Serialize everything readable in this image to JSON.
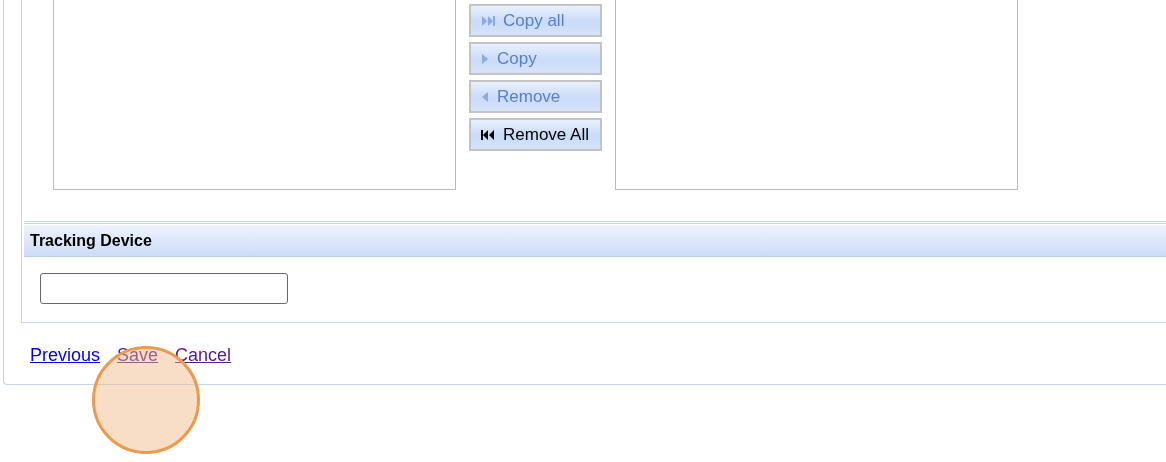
{
  "transfer_buttons": [
    {
      "kind": "copy_all",
      "label": "Copy all",
      "disabled": true
    },
    {
      "kind": "copy",
      "label": "Copy",
      "disabled": true
    },
    {
      "kind": "remove",
      "label": "Remove",
      "disabled": true
    },
    {
      "kind": "remove_all",
      "label": "Remove All",
      "disabled": false
    }
  ],
  "tracking_device": {
    "title": "Tracking Device"
  },
  "links": [
    {
      "label": "Previous",
      "visited": false
    },
    {
      "label": "Save",
      "visited": true
    },
    {
      "label": "Cancel",
      "visited": true
    }
  ]
}
